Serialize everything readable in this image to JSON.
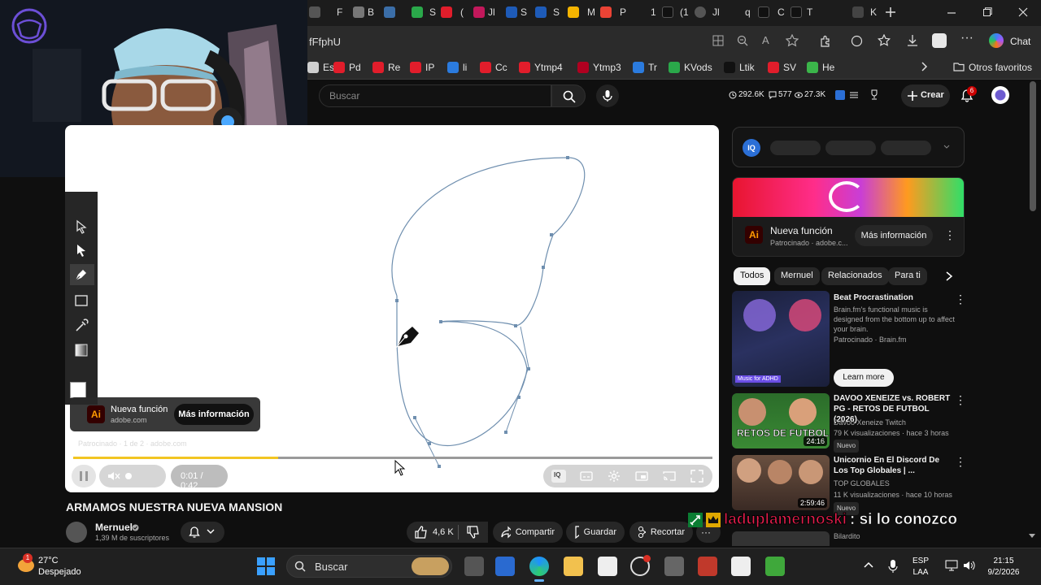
{
  "browser": {
    "url_fragment": "fFfphU",
    "chat_label": "Chat",
    "other_favorites": "Otros favoritos",
    "tab_letters": [
      "F",
      "B",
      "S",
      "(",
      "Jl",
      "S",
      "S",
      "M",
      "P",
      "1",
      "(1",
      "Jl",
      "q",
      "C",
      "T",
      "K"
    ],
    "bookmarks": [
      {
        "label": "Ess",
        "color": "#cfcfcf"
      },
      {
        "label": "Pd",
        "color": "#e11d2b"
      },
      {
        "label": "Re",
        "color": "#e11d2b"
      },
      {
        "label": "IP",
        "color": "#e11d2b"
      },
      {
        "label": "li",
        "color": "#2b7bde"
      },
      {
        "label": "Cc",
        "color": "#e11d2b"
      },
      {
        "label": "Ytmp4",
        "color": "#e11d2b"
      },
      {
        "label": "Ytmp3",
        "color": "#b00020"
      },
      {
        "label": "Tr",
        "color": "#2b7bde"
      },
      {
        "label": "KVods",
        "color": "#2aa84a"
      },
      {
        "label": "Ltik",
        "color": "#111111"
      },
      {
        "label": "SV",
        "color": "#e11d2b"
      },
      {
        "label": "He",
        "color": "#3bb54a"
      }
    ]
  },
  "youtube": {
    "search_placeholder": "Buscar",
    "stats": [
      "292.6K",
      "577",
      "27.3K"
    ],
    "create_label": "Crear",
    "notif_count": "6"
  },
  "player": {
    "ad_title": "Nueva función",
    "ad_domain": "adobe.com",
    "ad_cta": "Más información",
    "sponsored_line": "Patrocinado · 1 de 2 · adobe.com",
    "time": "0:01 / 0:42",
    "progress_fraction": 0.32,
    "buffer_fraction": 0.315
  },
  "video": {
    "title": "ARMAMOS NUESTRA NUEVA MANSION",
    "channel": "Mernuel",
    "subscribers": "1,39 M de suscriptores",
    "likes": "4,6 K",
    "share": "Compartir",
    "save": "Guardar",
    "clip": "Recortar"
  },
  "sidebar": {
    "ad": {
      "title": "Nueva función",
      "sponsor": "Patrocinado · adobe.c...",
      "cta": "Más información",
      "ai_label": "Ai"
    },
    "chips": [
      "Todos",
      "Mernuel",
      "Relacionados",
      "Para ti"
    ],
    "recs": [
      {
        "title": "Beat Procrastination",
        "desc": "Brain.fm's functional music is designed from the bottom up to affect your brain.",
        "meta": "Patrocinado · Brain.fm",
        "cta": "Learn more",
        "thumb_label": "Music for ADHD"
      },
      {
        "title": "DAVOO XENEIZE vs. ROBERT PG - RETOS DE FUTBOL (2026)",
        "channel": "Davoo Xeneize Twitch",
        "meta": "79 K visualizaciones · hace 3 horas",
        "badge": "Nuevo",
        "duration": "24:16",
        "thumb_label": "RETOS DE FUTBOL"
      },
      {
        "title": "Unicornio En El Discord De Los Top Globales | ...",
        "channel": "TOP GLOBALES",
        "meta": "11 K visualizaciones · hace 10 horas",
        "badge": "Nuevo",
        "duration": "2:59:46"
      },
      {
        "channel": "Bilardito"
      }
    ]
  },
  "overlay_chat": {
    "user": "laduplamernoski",
    "message": ": si lo conozco"
  },
  "taskbar": {
    "weather_temp": "27°C",
    "weather_desc": "Despejado",
    "weather_badge": "1",
    "search_label": "Buscar",
    "lang_top": "ESP",
    "lang_bottom": "LAA",
    "time": "21:15",
    "date": "9/2/2026"
  }
}
